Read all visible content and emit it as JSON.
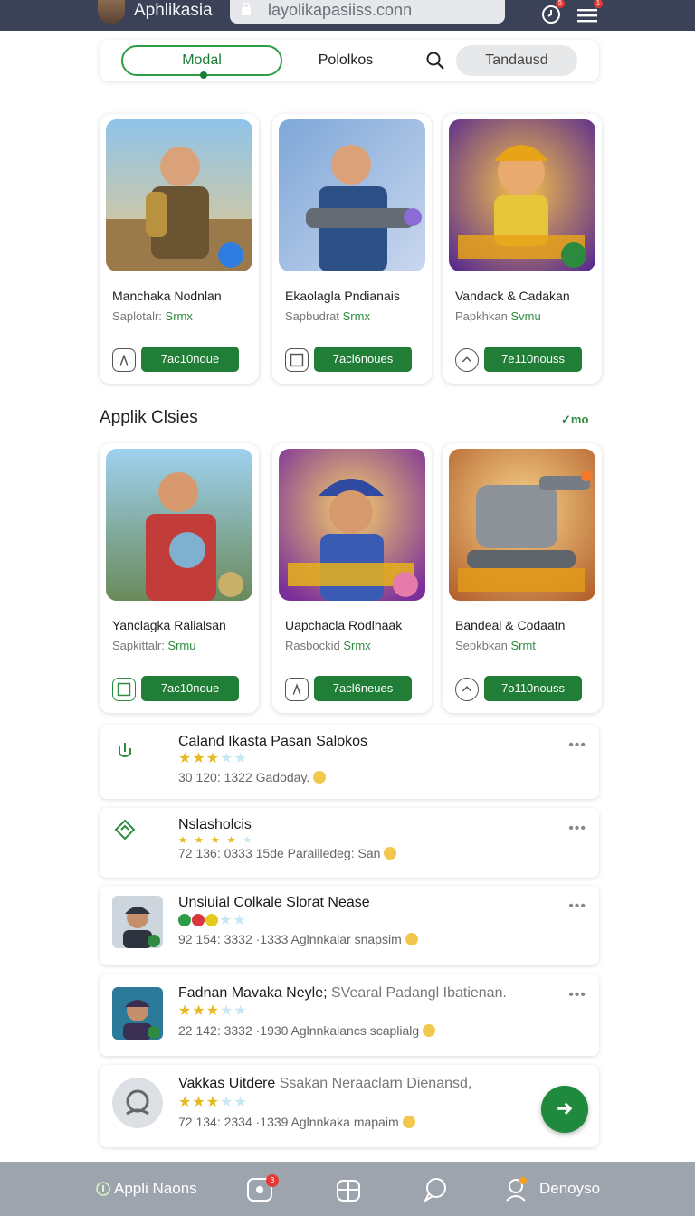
{
  "topbar": {
    "app_title": "Aphlikasia",
    "url": "layolikapasiiss.conn",
    "clock_badge": "5",
    "menu_badge": "1"
  },
  "tabs": {
    "modal": "Modal",
    "pololkos": "Pololkos",
    "tandausd": "Tandausd"
  },
  "top_cards": [
    {
      "title": "Manchaka Nodnlan",
      "sub_prefix": "Saplotalr: ",
      "sub_green": "Srmx",
      "install": "7ac10noue",
      "icon": "tap-icon"
    },
    {
      "title": "Ekaolagla Pndianais",
      "sub_prefix": "Sapbudrat ",
      "sub_green": "Srmx",
      "install": "7acl6noues",
      "icon": "square-icon"
    },
    {
      "title": "Vandack & Cadakan",
      "sub_prefix": "Papkhkan ",
      "sub_green": "Svmu",
      "install": "7e110nouss",
      "icon": "gauge-icon"
    }
  ],
  "section": {
    "title": "Applik Clsies",
    "more": "✓mo"
  },
  "bottom_cards": [
    {
      "title": "Yanclagka Ralialsan",
      "sub_prefix": "Sapkittalr: ",
      "sub_green": "Srmu",
      "install": "7ac10noue",
      "icon": "square-icon"
    },
    {
      "title": "Uapchacla Rodlhaak",
      "sub_prefix": "Rasbockid ",
      "sub_green": "Srmx",
      "install": "7acl6neues",
      "icon": "tap-icon"
    },
    {
      "title": "Bandeal & Codaatn",
      "sub_prefix": "Sepkbkan ",
      "sub_green": "Srmt",
      "install": "7o110nouss",
      "icon": "gauge-icon"
    }
  ],
  "reviews": [
    {
      "title": "Caland Ikasta Pasan Salokos",
      "title_muted": "",
      "rating": 3,
      "meta": "30 120: 1322 Gadoday."
    },
    {
      "title": "Nslasholcis",
      "title_muted": "",
      "rating": 4,
      "meta": "72 136: 0333  15de Parailledeg: San"
    },
    {
      "title": "Unsiuial Colkale Slorat Nease",
      "title_muted": "",
      "rating": 3,
      "meta": "92 154: 3332 ·1333  Aglnnkalar snapsim"
    },
    {
      "title": "Fadnan Mavaka Neyle; ",
      "title_muted": "SVearal Padangl Ibatienan.",
      "rating": 3,
      "meta": "22 142: 3332 ·1930  Aglnnkalancs scaplialg"
    },
    {
      "title": "Vakkas Uitdere ",
      "title_muted": "Ssakan Neraaclarn Dienansd,",
      "rating": 3,
      "meta": "72 134: 2334 ·1339  Aglnnkaka mapaim"
    }
  ],
  "bottom_nav": {
    "apps": "Appli Naons",
    "apps_badge": "3",
    "profile": "Denoyso"
  },
  "colors": {
    "green": "#217e36",
    "topbar": "#3b4257",
    "bottom_nav": "#9ea4ad"
  }
}
